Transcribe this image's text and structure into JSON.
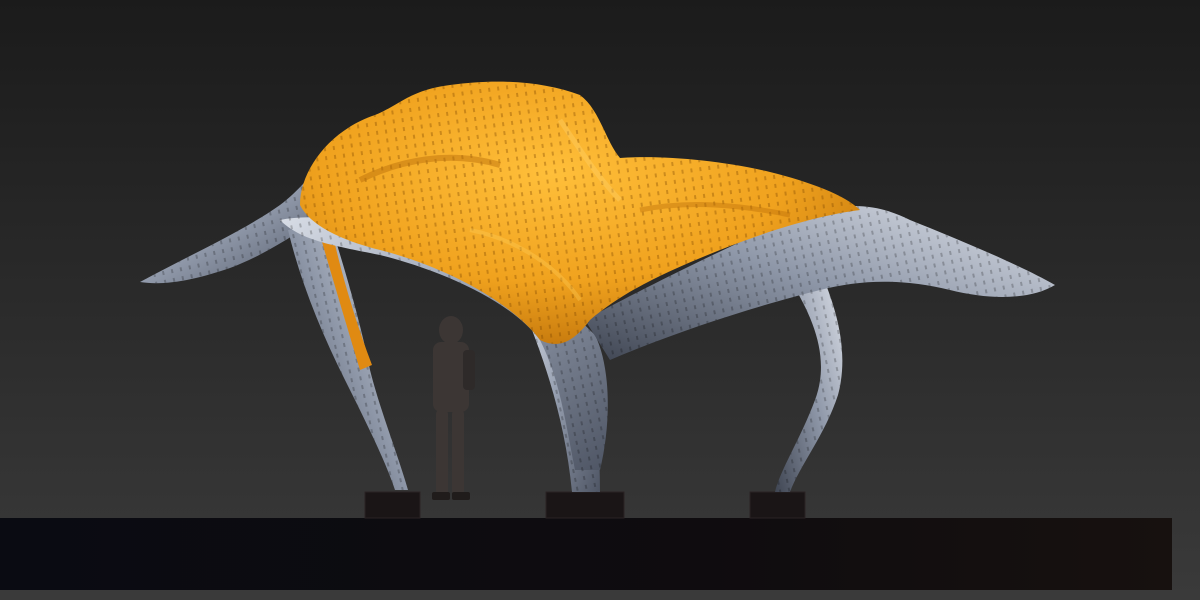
{
  "scene": {
    "subject": "sculpture-render",
    "colors": {
      "background_top": "#1b1b1b",
      "background_bottom": "#3a3a3a",
      "canopy_orange": "#f0a21e",
      "canopy_orange_dark": "#c47a0a",
      "ribbon_silver": "#a7b0c0",
      "ribbon_silver_dark": "#5c6474",
      "plinth": "#0d0c10",
      "base_pad": "#1a1516",
      "figure": "#3c3634"
    },
    "icons": [
      "canopy-sculpture",
      "silver-ribbon-supports",
      "human-figure",
      "base-pads",
      "plinth"
    ]
  }
}
